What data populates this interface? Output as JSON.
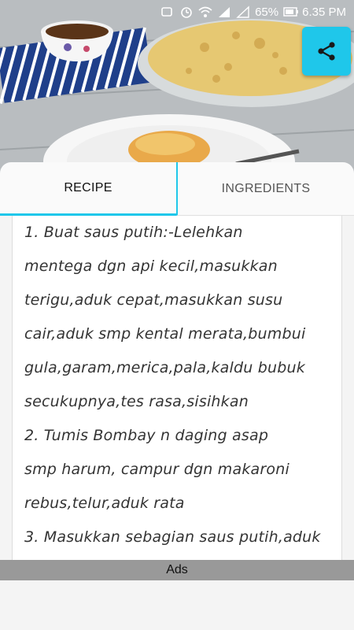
{
  "status_bar": {
    "battery": "65%",
    "time": "6.35 PM",
    "sim1": "1",
    "sim2": "2"
  },
  "hero": {
    "image": "macaroni-schotel-photo"
  },
  "tabs": [
    {
      "label": "RECIPE",
      "active": true
    },
    {
      "label": "INGREDIENTS",
      "active": false
    }
  ],
  "recipe": {
    "lines": [
      "1. Buat saus putih:-Lelehkan",
      "mentega dgn api kecil,masukkan",
      "terigu,aduk cepat,masukkan susu",
      "cair,aduk smp kental merata,bumbui",
      "gula,garam,merica,pala,kaldu bubuk",
      "secukupnya,tes rasa,sisihkan",
      "2. Tumis Bombay n daging asap",
      "smp harum, campur dgn makaroni",
      "rebus,telur,aduk rata",
      "3. Masukkan sebagian saus putih,aduk"
    ]
  },
  "ads": {
    "label": "Ads"
  },
  "colors": {
    "accent": "#1fc7ea",
    "ads_bar": "#999999"
  }
}
